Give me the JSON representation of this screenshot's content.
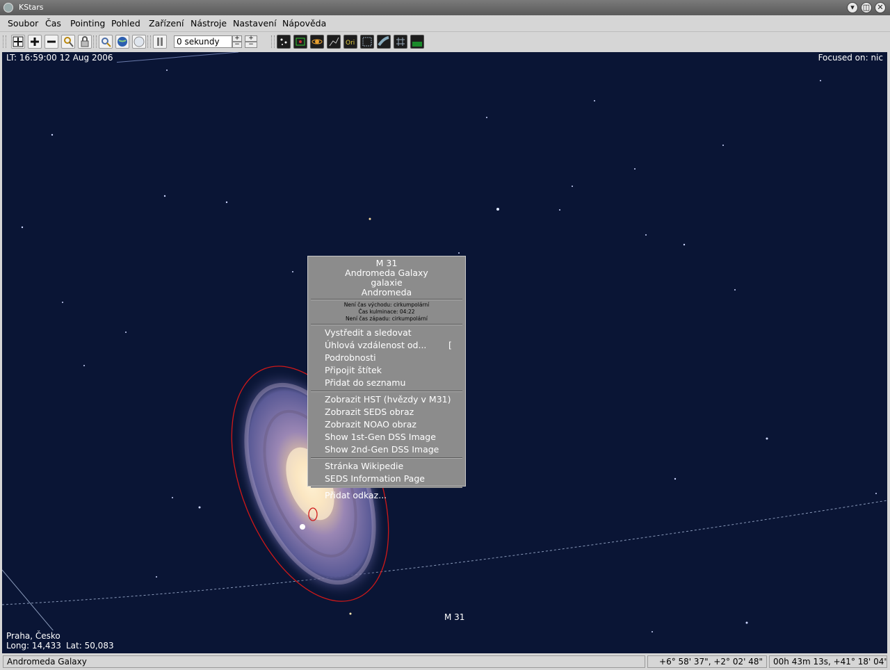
{
  "window": {
    "title": "KStars"
  },
  "menu": [
    "Soubor",
    "Čas",
    "Pointing",
    "Pohled",
    "Zařízení",
    "Nástroje",
    "Nastavení",
    "Nápověda"
  ],
  "toolbar": {
    "time_step": "0 sekundy"
  },
  "sky": {
    "local_time": "LT: 16:59:00   12 Aug 2006",
    "focus": "Focused on: nic",
    "location": "Praha, Česko",
    "longitude": "Long: 14,433",
    "latitude": "Lat: 50,083",
    "object_label": "M 31"
  },
  "popup": {
    "header": [
      "M 31",
      "Andromeda Galaxy",
      "galaxie",
      "Andromeda"
    ],
    "times": [
      "Není čas východu: cirkumpolární",
      "Čas kulminace: 04:22",
      "Není čas západu: cirkumpolární"
    ],
    "group1": [
      "Vystředit a sledovat",
      "Úhlová vzdálenost od...",
      "Podrobnosti",
      "Připojit štítek",
      "Přidat do seznamu"
    ],
    "shortcut_bracket": "[",
    "group2": [
      "Zobrazit HST (hvězdy v M31)",
      "Zobrazit SEDS obraz",
      "Zobrazit NOAO obraz",
      "Show 1st-Gen DSS Image",
      "Show 2nd-Gen DSS Image"
    ],
    "group3": [
      "Stránka Wikipedie",
      "SEDS Information Page"
    ],
    "group4": [
      "Přidat odkaz..."
    ]
  },
  "status": {
    "object": "Andromeda Galaxy",
    "altaz": "+6° 58' 37\",  +2° 02' 48\"",
    "radec": "00h 43m 13s,  +41° 18' 04\""
  }
}
